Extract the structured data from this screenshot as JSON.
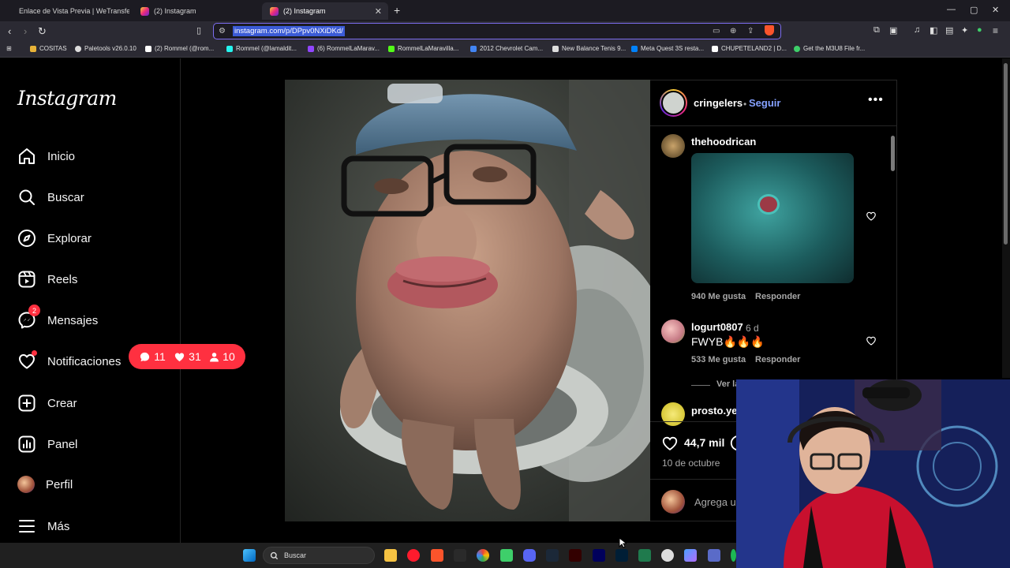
{
  "browser": {
    "tabs": [
      {
        "label": "Enlace de Vista Previa | WeTransfer"
      },
      {
        "label": "(2) Instagram"
      },
      {
        "label": "(2) Instagram"
      }
    ],
    "url": "instagram.com/p/DPpv0NXiDKd/",
    "bookmarks": [
      "COSITAS",
      "Paletools v26.0.10",
      "(2) Rommel (@rom...",
      "Rommel (@lamaldit...",
      "(6) RommelLaMarav...",
      "RommelLaMaravilla...",
      "2012 Chevrolet Cam...",
      "New Balance Tenis 9...",
      "Meta Quest 3S resta...",
      "CHUPETELAND2 | D...",
      "Get the M3U8 File fr..."
    ]
  },
  "sidebar": {
    "logo": "Instagram",
    "items": [
      {
        "label": "Inicio",
        "icon": "home-icon"
      },
      {
        "label": "Buscar",
        "icon": "search-icon"
      },
      {
        "label": "Explorar",
        "icon": "compass-icon"
      },
      {
        "label": "Reels",
        "icon": "reels-icon"
      },
      {
        "label": "Mensajes",
        "icon": "messenger-icon"
      },
      {
        "label": "Notificaciones",
        "icon": "heart-icon"
      },
      {
        "label": "Crear",
        "icon": "plus-square-icon"
      },
      {
        "label": "Panel",
        "icon": "chart-icon"
      },
      {
        "label": "Perfil",
        "icon": "avatar"
      },
      {
        "label": "Más",
        "icon": "menu-icon"
      }
    ],
    "messages_badge": "2",
    "notifications_pill": {
      "comments": "11",
      "likes": "31",
      "followers": "10"
    }
  },
  "post": {
    "username": "cringelers",
    "follow_separator": "•",
    "follow_label": "Seguir",
    "more": "•••",
    "comments": [
      {
        "user": "thehoodrican",
        "text": "",
        "has_gif": true,
        "likes": "940 Me gusta",
        "reply": "Responder",
        "time": ""
      },
      {
        "user": "logurt0807",
        "time": "6 d",
        "text": "FWYB🔥🔥🔥",
        "likes": "533 Me gusta",
        "reply": "Responder"
      },
      {
        "user": "prosto.yev",
        "text": "",
        "likes": "",
        "reply": "",
        "time": ""
      }
    ],
    "view_replies": "Ver la",
    "likes_count": "44,7 mil",
    "date": "10 de octubre",
    "add_comment_placeholder": "Agrega u"
  },
  "taskbar": {
    "search_label": "Buscar"
  },
  "colors": {
    "accent_follow": "#85a1ff",
    "notification_red": "#ff3040",
    "url_border": "#7c6df0"
  }
}
